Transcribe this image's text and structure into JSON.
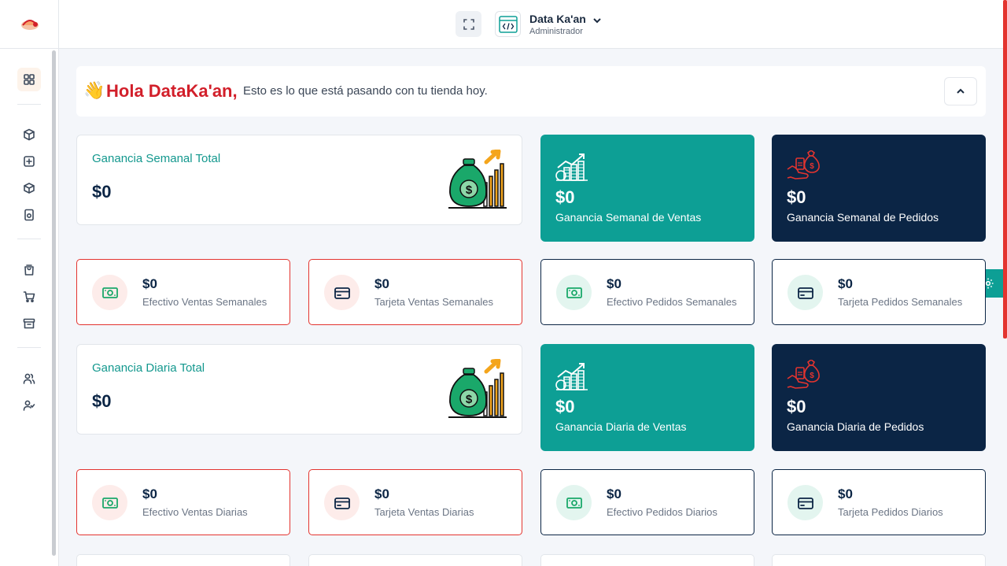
{
  "header": {
    "logo_alt": "Tacos logo",
    "user_name": "Data Ka'an",
    "user_role": "Administrador"
  },
  "greeting": {
    "emoji": "👋",
    "hello": "Hola DataKa'an,",
    "text": "Esto es lo que está pasando con tu tienda hoy."
  },
  "weekly": {
    "total_title": "Ganancia Semanal Total",
    "total_value": "$0",
    "sales_value": "$0",
    "sales_label": "Ganancia Semanal de Ventas",
    "orders_value": "$0",
    "orders_label": "Ganancia Semanal de Pedidos",
    "mini": [
      {
        "value": "$0",
        "label": "Efectivo Ventas Semanales"
      },
      {
        "value": "$0",
        "label": "Tarjeta Ventas Semanales"
      },
      {
        "value": "$0",
        "label": "Efectivo Pedidos Semanales"
      },
      {
        "value": "$0",
        "label": "Tarjeta Pedidos Semanales"
      }
    ]
  },
  "daily": {
    "total_title": "Ganancia Diaria Total",
    "total_value": "$0",
    "sales_value": "$0",
    "sales_label": "Ganancia Diaria de Ventas",
    "orders_value": "$0",
    "orders_label": "Ganancia Diaria de Pedidos",
    "mini": [
      {
        "value": "$0",
        "label": "Efectivo Ventas Diarias"
      },
      {
        "value": "$0",
        "label": "Tarjeta Ventas Diarias"
      },
      {
        "value": "$0",
        "label": "Efectivo Pedidos Diarios"
      },
      {
        "value": "$0",
        "label": "Tarjeta Pedidos Diarios"
      }
    ]
  },
  "colors": {
    "teal": "#0d9f95",
    "navy": "#0b2545",
    "red": "#e3342f",
    "green_icon": "#1aa86a"
  },
  "sidebar_icons": [
    "dashboard-icon",
    "box-icon",
    "plus-square-icon",
    "package-icon",
    "receipt-icon",
    "shopping-bag-icon",
    "cart-icon",
    "archive-icon",
    "users-icon",
    "user-check-icon"
  ]
}
